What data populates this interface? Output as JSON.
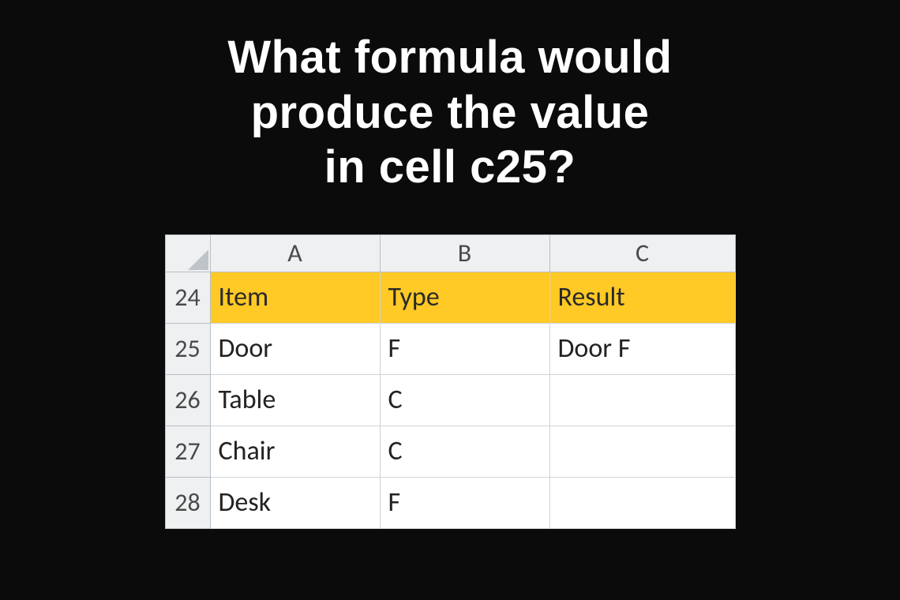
{
  "question": {
    "line1": "What formula would",
    "line2": "produce the value",
    "line3": "in cell c25?"
  },
  "columns": [
    "A",
    "B",
    "C"
  ],
  "row_numbers": [
    "24",
    "25",
    "26",
    "27",
    "28"
  ],
  "header_row": {
    "a": "Item",
    "b": "Type",
    "c": "Result"
  },
  "rows": [
    {
      "a": "Door",
      "b": "F",
      "c": "Door F"
    },
    {
      "a": "Table",
      "b": "C",
      "c": ""
    },
    {
      "a": "Chair",
      "b": "C",
      "c": ""
    },
    {
      "a": "Desk",
      "b": "F",
      "c": ""
    }
  ]
}
